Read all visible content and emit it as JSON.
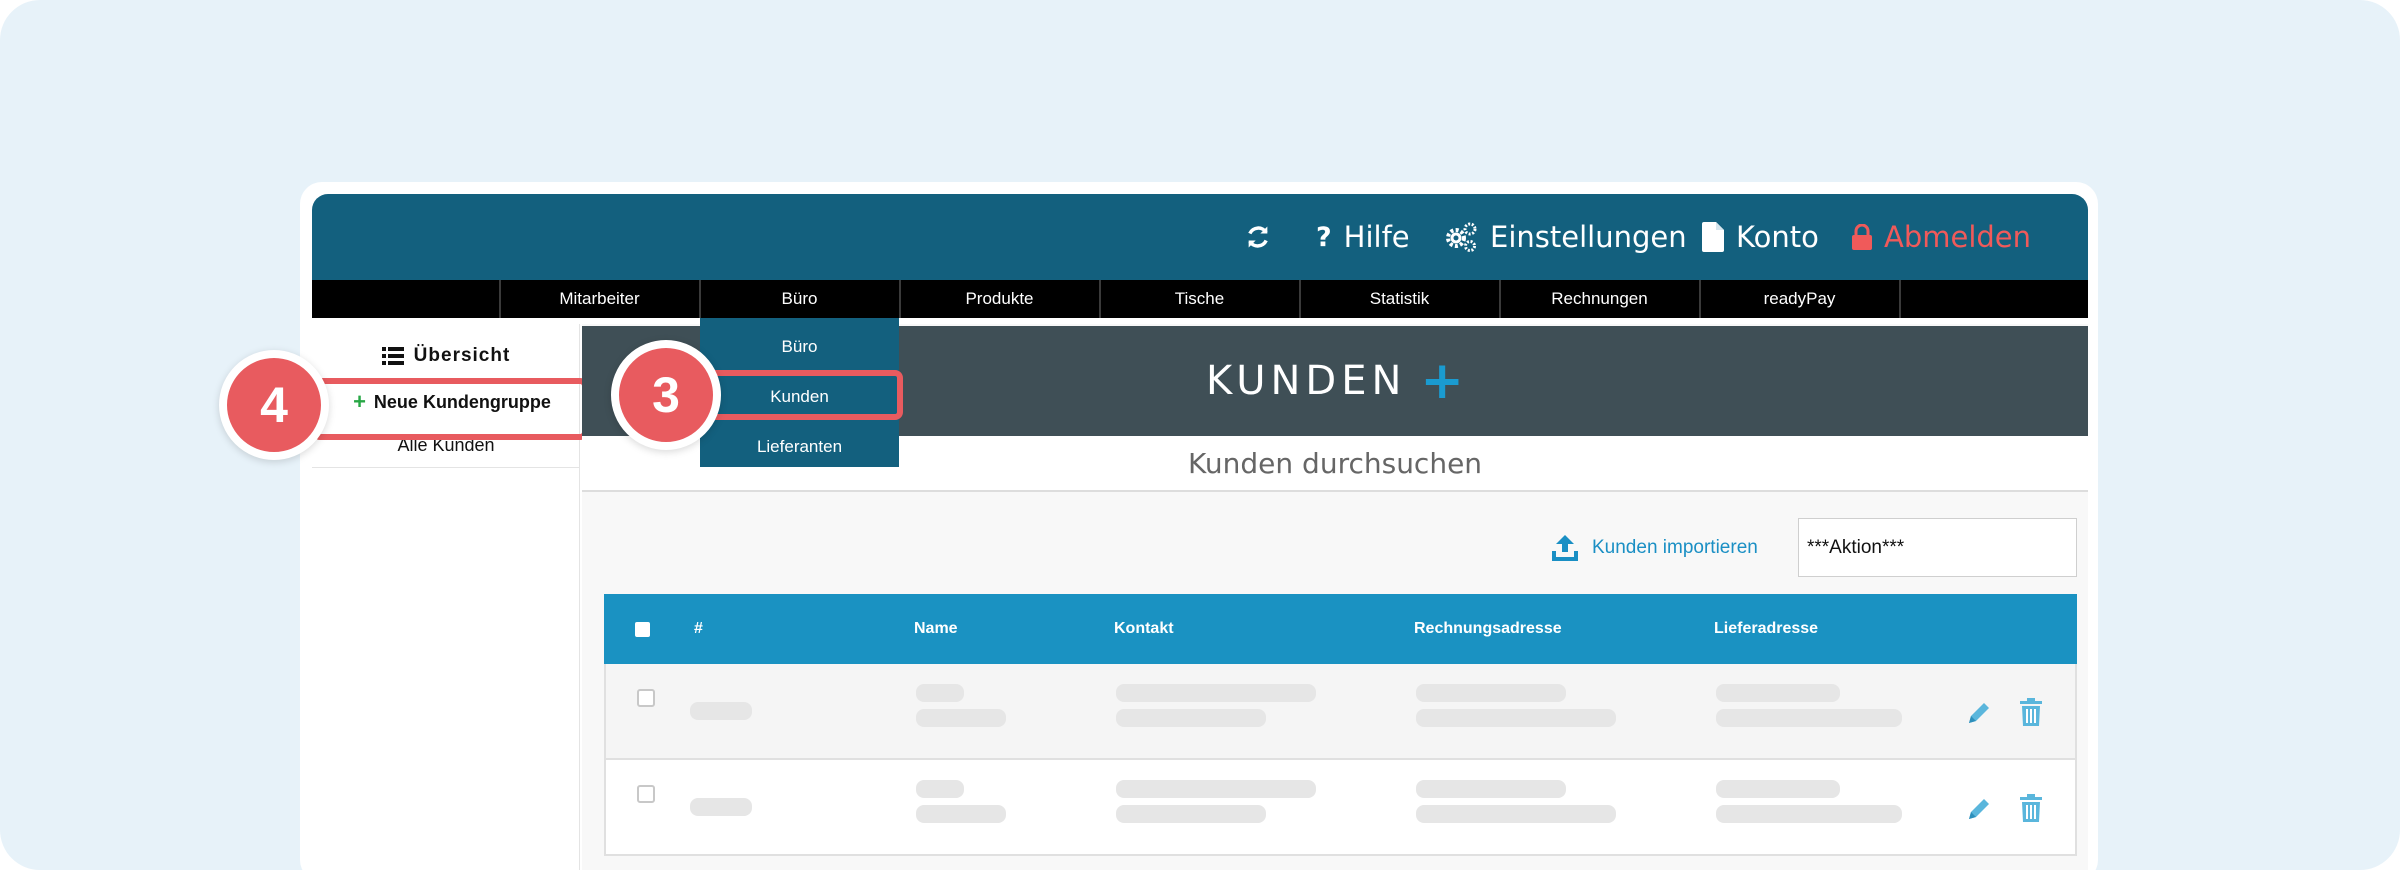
{
  "topbar": {
    "refresh_icon": "refresh-icon",
    "help_label": "Hilfe",
    "settings_label": "Einstellungen",
    "account_label": "Konto",
    "logout_label": "Abmelden",
    "logout_color": "#f05a5a"
  },
  "nav": {
    "items": [
      "Mitarbeiter",
      "Büro",
      "Produkte",
      "Tische",
      "Statistik",
      "Rechnungen",
      "readyPay"
    ]
  },
  "dropdown": {
    "items": [
      "Büro",
      "Kunden",
      "Lieferanten"
    ]
  },
  "sidebar": {
    "overview_label": "Übersicht",
    "new_group_label": "Neue Kundengruppe",
    "all_customers_label": "Alle Kunden"
  },
  "main": {
    "title": "KUNDEN",
    "search_label": "Kunden durchsuchen",
    "import_label": "Kunden importieren",
    "action_value": "***Aktion***"
  },
  "table": {
    "columns": [
      "#",
      "Name",
      "Kontakt",
      "Rechnungsadresse",
      "Lieferadresse"
    ]
  },
  "steps": {
    "step_3": "3",
    "step_4": "4"
  },
  "colors": {
    "header_blue": "#13607e",
    "table_header": "#1a92c2",
    "highlight_red": "#e85b5f",
    "accent_green": "#27a745"
  }
}
